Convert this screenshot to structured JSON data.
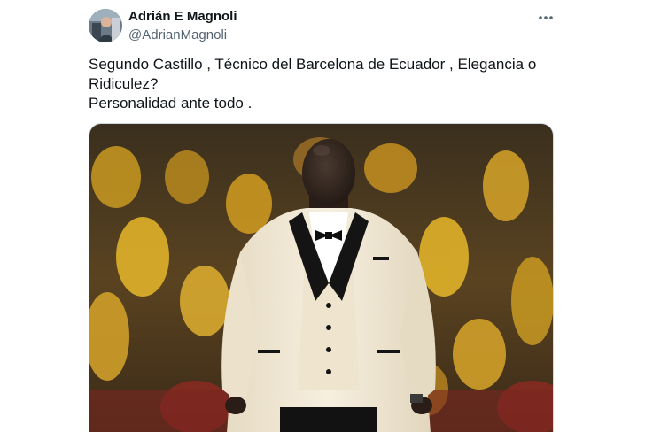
{
  "author": {
    "display_name": "Adrián E Magnoli",
    "handle": "@AdrianMagnoli"
  },
  "tweet": {
    "lines": [
      "Segundo Castillo , Técnico del Barcelona de Ecuador , Elegancia o",
      "Ridiculez?",
      "Personalidad ante todo ."
    ]
  },
  "icons": {
    "more": "more-horizontal-icon"
  },
  "colors": {
    "text": "#0f1419",
    "secondary": "#536471",
    "crowd_yellow": "#e8b82a",
    "jacket": "#f3ead6"
  }
}
